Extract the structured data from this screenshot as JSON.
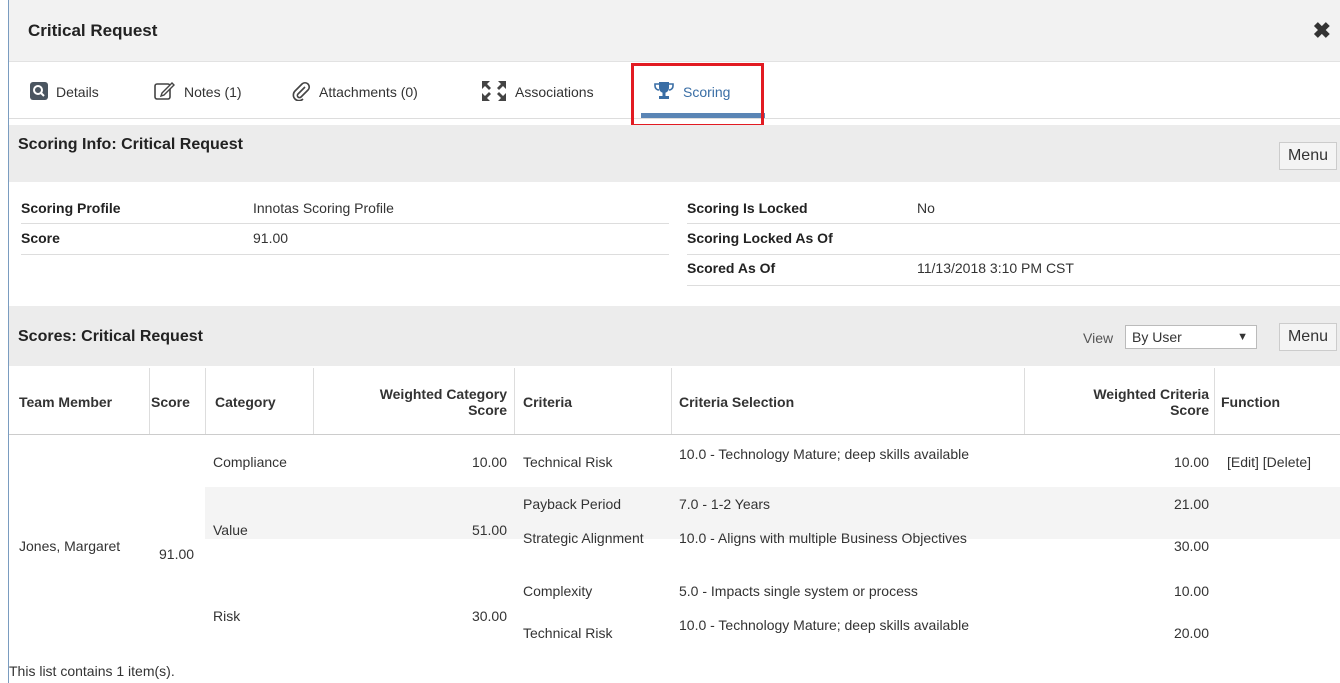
{
  "window": {
    "title": "Critical Request",
    "close_icon": "close-icon"
  },
  "tabs": [
    {
      "label": "Details",
      "icon": "search-icon"
    },
    {
      "label": "Notes (1)",
      "icon": "edit-icon"
    },
    {
      "label": "Attachments (0)",
      "icon": "paperclip-icon"
    },
    {
      "label": "Associations",
      "icon": "expand-icon"
    },
    {
      "label": "Scoring",
      "icon": "trophy-icon",
      "active": true
    }
  ],
  "scoring_info": {
    "title": "Scoring Info: Critical Request",
    "menu_label": "Menu",
    "fields": {
      "profile_label": "Scoring Profile",
      "profile_value": "Innotas Scoring Profile",
      "score_label": "Score",
      "score_value": "91.00",
      "locked_label": "Scoring Is Locked",
      "locked_value": "No",
      "locked_asof_label": "Scoring Locked As Of",
      "locked_asof_value": "",
      "scored_asof_label": "Scored As Of",
      "scored_asof_value": "11/13/2018 3:10 PM CST"
    }
  },
  "scores": {
    "title": "Scores: Critical Request",
    "view_label": "View",
    "view_value": "By User",
    "menu_label": "Menu",
    "columns": {
      "team_member": "Team Member",
      "score": "Score",
      "category": "Category",
      "weighted_category_score_1": "Weighted Category",
      "weighted_category_score_2": "Score",
      "criteria": "Criteria",
      "criteria_selection": "Criteria Selection",
      "weighted_criteria_score_1": "Weighted Criteria",
      "weighted_criteria_score_2": "Score",
      "function": "Function"
    },
    "member": {
      "name": "Jones, Margaret",
      "score": "91.00"
    },
    "categories": [
      {
        "name": "Compliance",
        "weighted": "10.00"
      },
      {
        "name": "Value",
        "weighted": "51.00"
      },
      {
        "name": "Risk",
        "weighted": "30.00"
      }
    ],
    "rows": [
      {
        "criteria": "Technical Risk",
        "selection": "10.0 - Technology Mature; deep skills available",
        "weighted": "10.00"
      },
      {
        "criteria": "Payback Period",
        "selection": "7.0 - 1-2 Years",
        "weighted": "21.00"
      },
      {
        "criteria": "Strategic Alignment",
        "selection": "10.0 - Aligns with multiple Business Objectives",
        "weighted": "30.00"
      },
      {
        "criteria": "Complexity",
        "selection": "5.0 - Impacts single system or process",
        "weighted": "10.00"
      },
      {
        "criteria": "Technical Risk",
        "selection": "10.0 - Technology Mature; deep skills available",
        "weighted": "20.00"
      }
    ],
    "function_links": {
      "edit": "[Edit]",
      "delete": "[Delete]"
    },
    "footer": "This list contains 1 item(s)."
  }
}
